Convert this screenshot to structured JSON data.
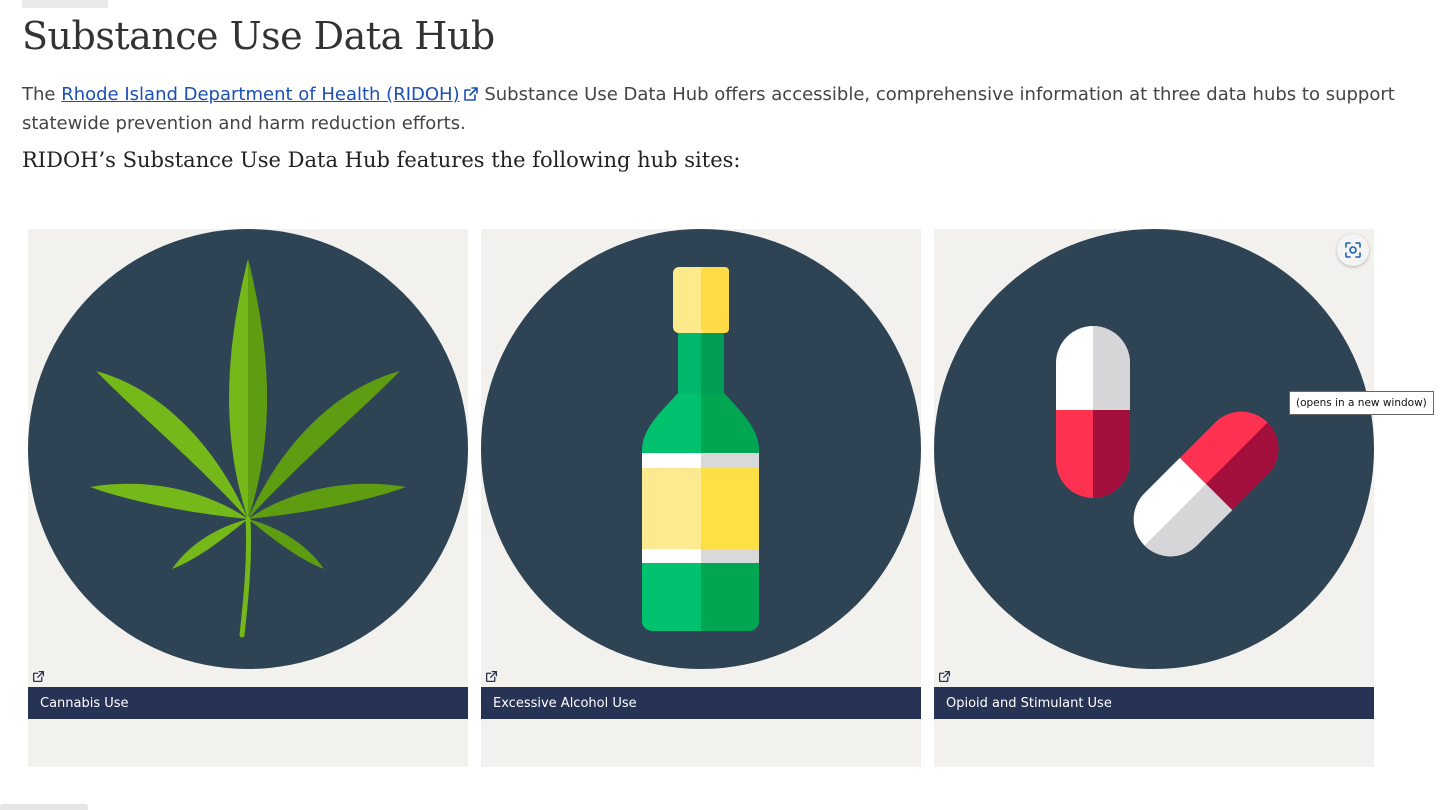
{
  "page": {
    "title": "Substance Use Data Hub",
    "intro_before": "The ",
    "intro_link": "Rhode Island Department of Health (RIDOH)",
    "intro_after": " Substance Use Data Hub offers accessible, comprehensive information at three data hubs to support statewide prevention and harm reduction efforts.",
    "subheading": "RIDOH’s Substance Use Data Hub features the following hub sites:"
  },
  "cards": [
    {
      "label": "Cannabis Use",
      "icon": "cannabis-leaf-icon"
    },
    {
      "label": "Excessive Alcohol Use",
      "icon": "bottle-icon"
    },
    {
      "label": "Opioid and Stimulant Use",
      "icon": "pills-icon"
    }
  ],
  "tooltip": {
    "text": "(opens in a new window)"
  },
  "colors": {
    "circle": "#2e4353",
    "card_bg": "#f2f1ed",
    "label_bar": "#263355",
    "link": "#1a4fb5"
  }
}
